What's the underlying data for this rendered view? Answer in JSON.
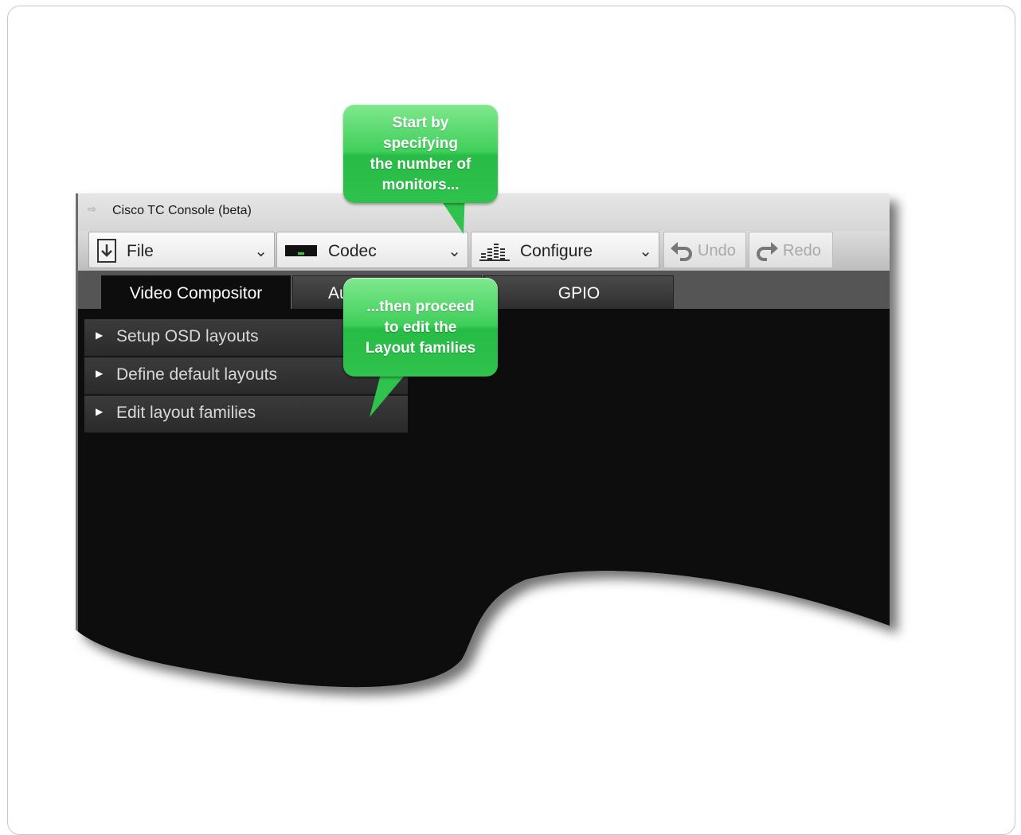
{
  "window": {
    "title": "Cisco TC Console (beta)"
  },
  "toolbar": {
    "file_label": "File",
    "codec_label": "Codec",
    "configure_label": "Configure",
    "undo_label": "Undo",
    "redo_label": "Redo"
  },
  "tabs": [
    {
      "label": "Video Compositor",
      "active": true
    },
    {
      "label": "Au",
      "active": false
    },
    {
      "label": "",
      "active": false
    },
    {
      "label": "GPIO",
      "active": false
    }
  ],
  "panel": {
    "items": [
      {
        "label": "Setup OSD layouts"
      },
      {
        "label": "Define default layouts"
      },
      {
        "label": "Edit layout families"
      }
    ]
  },
  "callouts": {
    "top": [
      "Start by",
      "specifying",
      "the number of",
      "monitors..."
    ],
    "middle": [
      "...then proceed",
      "to edit the",
      "Layout families"
    ]
  },
  "colors": {
    "callout_green": "#3fcf5a",
    "app_background": "#0d0d0d",
    "toolbar_grey": "#d0d0d0"
  }
}
